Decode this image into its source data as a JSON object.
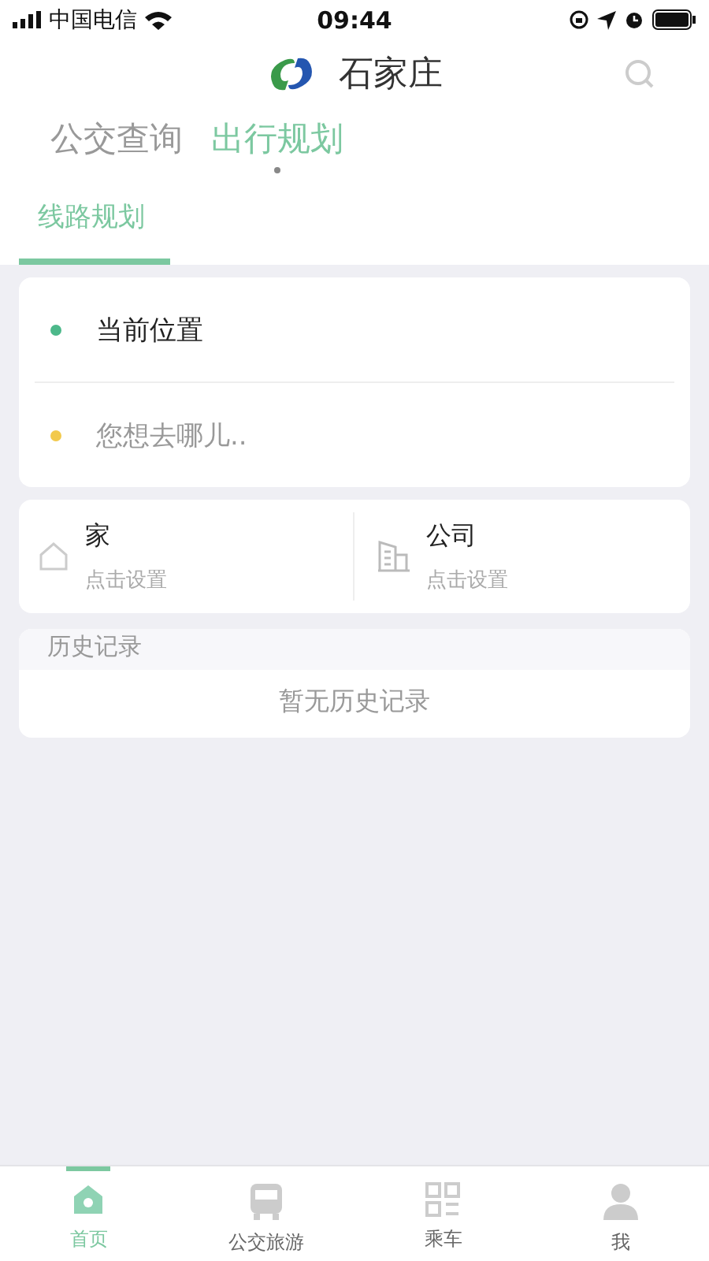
{
  "status_bar": {
    "carrier": "中国电信",
    "time": "09:44"
  },
  "header": {
    "city": "石家庄"
  },
  "tabs": [
    {
      "label": "公交查询",
      "selected": false
    },
    {
      "label": "出行规划",
      "selected": true
    }
  ],
  "sub_tabs": [
    {
      "label": "线路规划",
      "selected": true
    }
  ],
  "route": [
    {
      "text": "当前位置",
      "kind": "value",
      "color": "#4cb88a"
    },
    {
      "text": "您想去哪儿..",
      "kind": "placeholder",
      "color": "#f2c94c"
    }
  ],
  "shortcuts": [
    {
      "kind": "home",
      "title": "家",
      "hint": "点击设置"
    },
    {
      "kind": "office",
      "title": "公司",
      "hint": "点击设置"
    }
  ],
  "history": {
    "title": "历史记录",
    "empty": "暂无历史记录"
  },
  "nav": [
    {
      "kind": "home",
      "label": "首页",
      "selected": true
    },
    {
      "kind": "bus",
      "label": "公交旅游",
      "selected": false
    },
    {
      "kind": "grid",
      "label": "乘车",
      "selected": false
    },
    {
      "kind": "person",
      "label": "我",
      "selected": false
    }
  ]
}
